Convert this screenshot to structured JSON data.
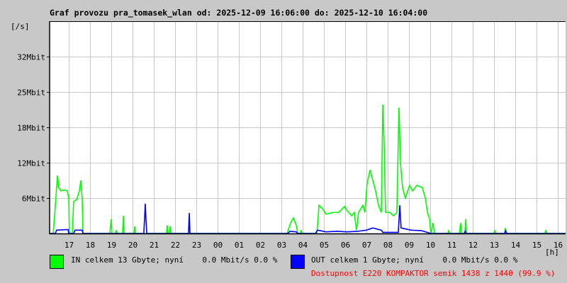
{
  "title": "Graf provozu pra_tomasek_wlan od: 2025-12-09 16:06:00 do: 2025-12-10 16:04:00",
  "legend": {
    "in_text": "IN celkem 13 Gbyte; nyní    0.0 Mbit/s 0.0 %",
    "out_text": "OUT celkem 1 Gbyte; nyní    0.0 Mbit/s 0.0 %",
    "availability": "Dostupnost E220 KOMPAKTOR semik 1438 z 1440 (99.9 %)"
  },
  "chart_data": {
    "type": "line",
    "title": "Graf provozu pra_tomasek_wlan od: 2025-12-09 16:06:00 do: 2025-12-10 16:04:00",
    "xlabel": "[h]",
    "ylabel": "[/s]",
    "x_unit": "hours since 2025-12-09 16:06",
    "xlim": [
      0,
      24.27
    ],
    "ylim": [
      0,
      38.4
    ],
    "grid": true,
    "x_ticks": [
      {
        "t": 0.9,
        "label": "17"
      },
      {
        "t": 1.9,
        "label": "18"
      },
      {
        "t": 2.9,
        "label": "19"
      },
      {
        "t": 3.9,
        "label": "20"
      },
      {
        "t": 4.9,
        "label": "21"
      },
      {
        "t": 5.9,
        "label": "22"
      },
      {
        "t": 6.9,
        "label": "23"
      },
      {
        "t": 7.9,
        "label": "00"
      },
      {
        "t": 8.9,
        "label": "01"
      },
      {
        "t": 9.9,
        "label": "02"
      },
      {
        "t": 10.9,
        "label": "03"
      },
      {
        "t": 11.9,
        "label": "04"
      },
      {
        "t": 12.9,
        "label": "05"
      },
      {
        "t": 13.9,
        "label": "06"
      },
      {
        "t": 14.9,
        "label": "07"
      },
      {
        "t": 15.9,
        "label": "08"
      },
      {
        "t": 16.9,
        "label": "09"
      },
      {
        "t": 17.9,
        "label": "10"
      },
      {
        "t": 18.9,
        "label": "11"
      },
      {
        "t": 19.9,
        "label": "12"
      },
      {
        "t": 20.9,
        "label": "13"
      },
      {
        "t": 21.9,
        "label": "14"
      },
      {
        "t": 22.9,
        "label": "15"
      },
      {
        "t": 23.9,
        "label": "16"
      }
    ],
    "y_ticks": [
      {
        "v": 6.4,
        "label": "6Mbit"
      },
      {
        "v": 12.8,
        "label": "12Mbit"
      },
      {
        "v": 19.2,
        "label": "18Mbit"
      },
      {
        "v": 25.6,
        "label": "25Mbit"
      },
      {
        "v": 32.0,
        "label": "32Mbit"
      }
    ],
    "series": [
      {
        "name": "IN",
        "color": "#00ff00",
        "points": [
          [
            0,
            0
          ],
          [
            0.17,
            0
          ],
          [
            0.27,
            5.1
          ],
          [
            0.37,
            10.5
          ],
          [
            0.43,
            8.3
          ],
          [
            0.53,
            7.7
          ],
          [
            0.67,
            7.9
          ],
          [
            0.83,
            7.7
          ],
          [
            0.9,
            6.4
          ],
          [
            0.93,
            0
          ],
          [
            1.07,
            0
          ],
          [
            1.13,
            5.8
          ],
          [
            1.27,
            6.1
          ],
          [
            1.4,
            7.7
          ],
          [
            1.47,
            9.6
          ],
          [
            1.53,
            6.4
          ],
          [
            1.57,
            0
          ],
          [
            2.83,
            0
          ],
          [
            2.9,
            2.6
          ],
          [
            2.93,
            0
          ],
          [
            3.1,
            0
          ],
          [
            3.13,
            0.6
          ],
          [
            3.17,
            0
          ],
          [
            3.43,
            0
          ],
          [
            3.47,
            3.2
          ],
          [
            3.5,
            0
          ],
          [
            3.97,
            0
          ],
          [
            4.0,
            1.3
          ],
          [
            4.03,
            0
          ],
          [
            5.5,
            0
          ],
          [
            5.53,
            1.5
          ],
          [
            5.57,
            0
          ],
          [
            5.63,
            0
          ],
          [
            5.67,
            1.3
          ],
          [
            5.7,
            0
          ],
          [
            11.17,
            0
          ],
          [
            11.33,
            1.9
          ],
          [
            11.47,
            2.8
          ],
          [
            11.6,
            1.5
          ],
          [
            11.67,
            0
          ],
          [
            11.8,
            0
          ],
          [
            11.83,
            0.6
          ],
          [
            11.87,
            0
          ],
          [
            12.57,
            0
          ],
          [
            12.67,
            5.1
          ],
          [
            12.83,
            4.5
          ],
          [
            13.0,
            3.5
          ],
          [
            13.33,
            3.8
          ],
          [
            13.6,
            3.8
          ],
          [
            13.87,
            4.9
          ],
          [
            14.0,
            4.1
          ],
          [
            14.2,
            3.2
          ],
          [
            14.33,
            3.8
          ],
          [
            14.43,
            0.6
          ],
          [
            14.53,
            3.8
          ],
          [
            14.73,
            5.1
          ],
          [
            14.83,
            3.8
          ],
          [
            14.93,
            9.0
          ],
          [
            15.07,
            11.5
          ],
          [
            15.2,
            9.6
          ],
          [
            15.33,
            7.7
          ],
          [
            15.47,
            5.1
          ],
          [
            15.6,
            3.8
          ],
          [
            15.67,
            23.3
          ],
          [
            15.73,
            16.6
          ],
          [
            15.8,
            3.8
          ],
          [
            16.0,
            3.8
          ],
          [
            16.17,
            3.2
          ],
          [
            16.33,
            3.8
          ],
          [
            16.43,
            22.8
          ],
          [
            16.5,
            12.8
          ],
          [
            16.6,
            8.3
          ],
          [
            16.73,
            6.4
          ],
          [
            16.93,
            8.7
          ],
          [
            17.07,
            7.7
          ],
          [
            17.27,
            8.7
          ],
          [
            17.53,
            8.3
          ],
          [
            17.67,
            6.4
          ],
          [
            17.77,
            3.8
          ],
          [
            17.87,
            2.6
          ],
          [
            17.93,
            0
          ],
          [
            18.03,
            1.9
          ],
          [
            18.1,
            0
          ],
          [
            18.73,
            0
          ],
          [
            18.77,
            0.6
          ],
          [
            18.8,
            0
          ],
          [
            19.27,
            0
          ],
          [
            19.33,
            1.9
          ],
          [
            19.37,
            0
          ],
          [
            19.53,
            0
          ],
          [
            19.57,
            2.6
          ],
          [
            19.6,
            0
          ],
          [
            20.9,
            0
          ],
          [
            20.93,
            0.6
          ],
          [
            20.97,
            0
          ],
          [
            21.4,
            0
          ],
          [
            21.43,
            1.0
          ],
          [
            21.47,
            0
          ],
          [
            23.3,
            0
          ],
          [
            23.33,
            0.6
          ],
          [
            23.37,
            0
          ],
          [
            24.27,
            0
          ]
        ]
      },
      {
        "name": "OUT",
        "color": "#0000ff",
        "points": [
          [
            0,
            0
          ],
          [
            0.27,
            0
          ],
          [
            0.33,
            0.6
          ],
          [
            0.87,
            0.7
          ],
          [
            0.9,
            0
          ],
          [
            1.13,
            0
          ],
          [
            1.2,
            0.6
          ],
          [
            1.53,
            0.6
          ],
          [
            1.57,
            0
          ],
          [
            4.43,
            0
          ],
          [
            4.5,
            5.4
          ],
          [
            4.53,
            2.6
          ],
          [
            4.57,
            0
          ],
          [
            6.53,
            0
          ],
          [
            6.57,
            3.7
          ],
          [
            6.6,
            0
          ],
          [
            11.2,
            0
          ],
          [
            11.3,
            0.4
          ],
          [
            11.6,
            0.3
          ],
          [
            11.67,
            0
          ],
          [
            12.5,
            0
          ],
          [
            12.6,
            0.6
          ],
          [
            13.0,
            0.3
          ],
          [
            13.5,
            0.4
          ],
          [
            14.0,
            0.3
          ],
          [
            14.5,
            0.4
          ],
          [
            14.9,
            0.6
          ],
          [
            15.2,
            1.0
          ],
          [
            15.6,
            0.6
          ],
          [
            15.67,
            0.2
          ],
          [
            16.4,
            0.2
          ],
          [
            16.47,
            5.1
          ],
          [
            16.53,
            1.0
          ],
          [
            17.0,
            0.6
          ],
          [
            17.5,
            0.5
          ],
          [
            17.93,
            0
          ],
          [
            19.5,
            0
          ],
          [
            19.55,
            0.4
          ],
          [
            19.6,
            0
          ],
          [
            21.4,
            0
          ],
          [
            21.45,
            0.5
          ],
          [
            21.5,
            0
          ],
          [
            24.27,
            0
          ]
        ]
      }
    ]
  }
}
